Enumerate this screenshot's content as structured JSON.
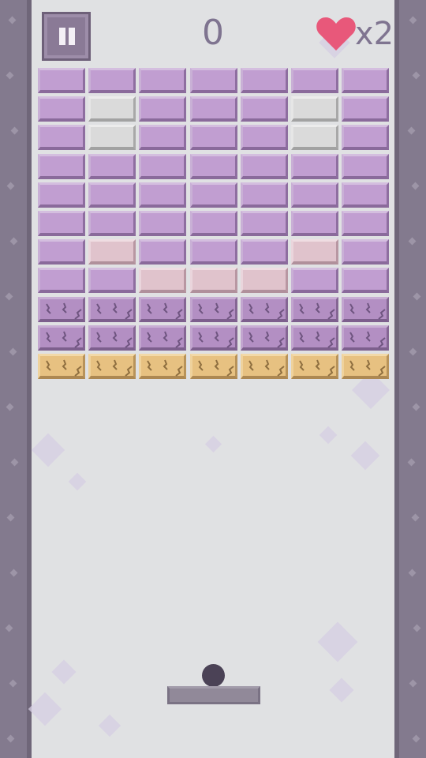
{
  "hud": {
    "score": "0",
    "lives_text": "x2",
    "pause_icon": "pause-icon",
    "life_icon": "heart-icon"
  },
  "colors": {
    "background": "#e0e1e3",
    "wall": "#837a8e",
    "purple_brick": "#c19ed1",
    "gray_brick": "#dadada",
    "pink_brick": "#e0c3cc",
    "cracked_brick": "#b38fc3",
    "gold_brick": "#e7c181",
    "heart": "#e8587a",
    "ball": "#4b4256",
    "paddle": "#918999"
  },
  "bricks": {
    "columns": 7,
    "rows": [
      [
        "purple",
        "purple",
        "purple",
        "purple",
        "purple",
        "purple",
        "purple"
      ],
      [
        "purple",
        "gray",
        "purple",
        "purple",
        "purple",
        "gray",
        "purple"
      ],
      [
        "purple",
        "gray",
        "purple",
        "purple",
        "purple",
        "gray",
        "purple"
      ],
      [
        "purple",
        "purple",
        "purple",
        "purple",
        "purple",
        "purple",
        "purple"
      ],
      [
        "purple",
        "purple",
        "purple",
        "purple",
        "purple",
        "purple",
        "purple"
      ],
      [
        "purple",
        "purple",
        "purple",
        "purple",
        "purple",
        "purple",
        "purple"
      ],
      [
        "purple",
        "pink",
        "purple",
        "purple",
        "purple",
        "pink",
        "purple"
      ],
      [
        "purple",
        "purple",
        "pink",
        "pink",
        "pink",
        "purple",
        "purple"
      ],
      [
        "cracked",
        "cracked",
        "cracked",
        "cracked",
        "cracked",
        "cracked",
        "cracked"
      ],
      [
        "cracked",
        "cracked",
        "cracked",
        "cracked",
        "cracked",
        "cracked",
        "cracked"
      ],
      [
        "gold",
        "gold",
        "gold",
        "gold",
        "gold",
        "gold",
        "gold"
      ]
    ]
  }
}
